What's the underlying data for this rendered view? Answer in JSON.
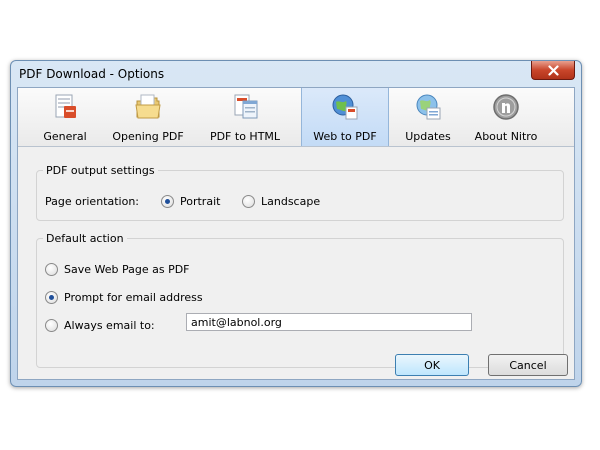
{
  "window": {
    "title": "PDF Download - Options"
  },
  "toolbar": {
    "items": [
      {
        "label": "General",
        "icon": "general-settings-icon"
      },
      {
        "label": "Opening PDF",
        "icon": "folder-icon"
      },
      {
        "label": "PDF to HTML",
        "icon": "html-page-icon"
      },
      {
        "label": "Web to PDF",
        "icon": "web-globe-icon",
        "active": true
      },
      {
        "label": "Updates",
        "icon": "update-globe-icon"
      },
      {
        "label": "About Nitro",
        "icon": "nitro-logo-icon"
      }
    ]
  },
  "output_settings": {
    "legend": "PDF output settings",
    "orientation_label": "Page orientation:",
    "portrait_label": "Portrait",
    "landscape_label": "Landscape",
    "selected": "Portrait"
  },
  "default_action": {
    "legend": "Default action",
    "save_label": "Save Web Page as PDF",
    "prompt_label": "Prompt for email address",
    "always_label": "Always email to:",
    "email_value": "amit@labnol.org",
    "selected": "Prompt for email address"
  },
  "buttons": {
    "ok": "OK",
    "cancel": "Cancel"
  },
  "colors": {
    "title_bar": "#cfe0f3",
    "close_button": "#c9462b",
    "active_tab": "#c3dbf6"
  }
}
